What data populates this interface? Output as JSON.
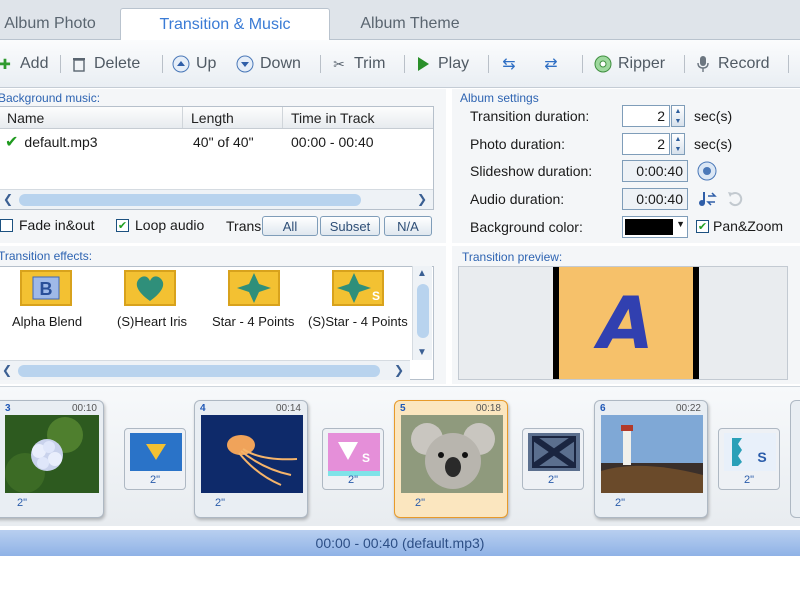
{
  "tabs": [
    {
      "label": "Album Photo"
    },
    {
      "label": "Transition & Music"
    },
    {
      "label": "Album Theme"
    }
  ],
  "toolbar": {
    "add": "Add",
    "delete": "Delete",
    "up": "Up",
    "down": "Down",
    "trim": "Trim",
    "play": "Play",
    "ripper": "Ripper",
    "record": "Record"
  },
  "music": {
    "group_title": "Background music:",
    "columns": [
      "Name",
      "Length",
      "Time in Track"
    ],
    "rows": [
      {
        "name": "default.mp3",
        "length": "40\" of 40\"",
        "time": "00:00 - 00:40"
      }
    ],
    "fade_label": "Fade in&out",
    "loop_label": "Loop audio",
    "transi_label": "Transi",
    "btn_all": "All",
    "btn_subset": "Subset",
    "btn_na": "N/A"
  },
  "album_settings": {
    "group_title": "Album settings",
    "transition_duration_label": "Transition duration:",
    "transition_duration_value": "2",
    "photo_duration_label": "Photo duration:",
    "photo_duration_value": "2",
    "unit": "sec(s)",
    "slideshow_duration_label": "Slideshow duration:",
    "slideshow_duration_value": "0:00:40",
    "audio_duration_label": "Audio duration:",
    "audio_duration_value": "0:00:40",
    "bg_color_label": "Background color:",
    "bg_color": "#000000",
    "panzoom_label": "Pan&Zoom"
  },
  "effects": {
    "group_title": "Transition effects:",
    "items": [
      {
        "label": "Alpha Blend",
        "icon": "alpha-blend-icon"
      },
      {
        "label": "(S)Heart Iris",
        "icon": "heart-icon"
      },
      {
        "label": "Star - 4 Points",
        "icon": "star-icon"
      },
      {
        "label": "(S)Star - 4 Points",
        "icon": "star-s-icon"
      }
    ]
  },
  "preview": {
    "group_title": "Transition preview:",
    "letter": "A"
  },
  "storyboard": {
    "slides": [
      {
        "num": "3",
        "time": "00:10",
        "dur": "2\""
      },
      {
        "num": "4",
        "time": "00:14",
        "dur": "2\""
      },
      {
        "num": "5",
        "time": "00:18",
        "dur": "2\""
      },
      {
        "num": "6",
        "time": "00:22",
        "dur": "2\""
      }
    ],
    "transitions": [
      {
        "dur": "2\""
      },
      {
        "dur": "2\""
      },
      {
        "dur": "2\""
      },
      {
        "dur": "2\""
      }
    ]
  },
  "status": {
    "text": "00:00 - 00:40 (default.mp3)"
  },
  "colors": {
    "accent": "#3a7bd5",
    "selected_card": "#fbe6bf",
    "effect_tile": "#f3c132"
  }
}
